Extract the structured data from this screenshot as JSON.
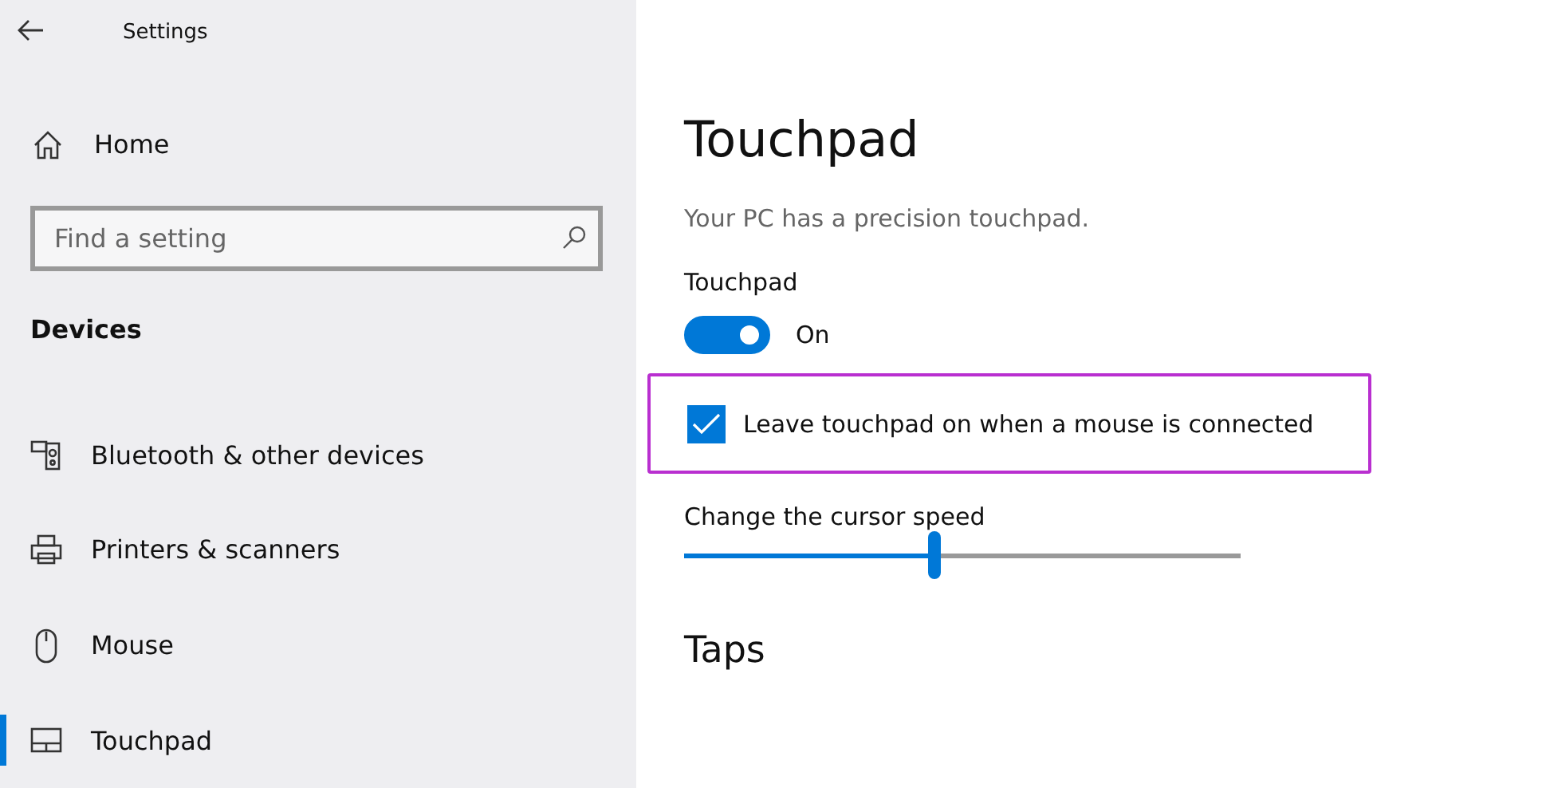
{
  "window": {
    "title": "Settings"
  },
  "sidebar": {
    "home": "Home",
    "search": {
      "placeholder": "Find a setting"
    },
    "section": "Devices",
    "items": [
      {
        "label": "Bluetooth & other devices",
        "kind": "bluetooth",
        "selected": false
      },
      {
        "label": "Printers & scanners",
        "kind": "printer",
        "selected": false
      },
      {
        "label": "Mouse",
        "kind": "mouse",
        "selected": false
      },
      {
        "label": "Touchpad",
        "kind": "touchpad",
        "selected": true
      }
    ]
  },
  "page": {
    "title": "Touchpad",
    "description": "Your PC has a precision touchpad.",
    "toggle": {
      "label": "Touchpad",
      "on": true,
      "state": "On"
    },
    "checkbox": {
      "label": "Leave touchpad on when a mouse is connected",
      "checked": true,
      "highlighted": true
    },
    "slider": {
      "label": "Change the cursor speed",
      "level": 0.45
    },
    "next_section": "Taps"
  }
}
